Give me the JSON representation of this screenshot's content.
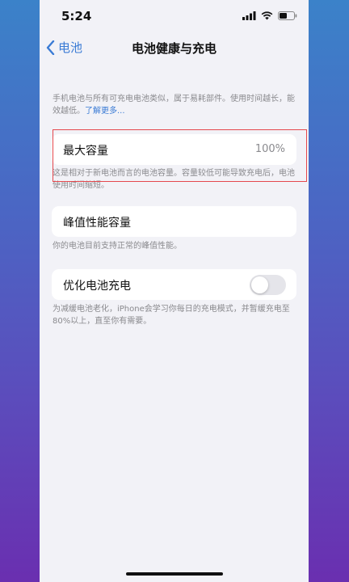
{
  "status": {
    "time": "5:24"
  },
  "nav": {
    "back_label": "电池",
    "title": "电池健康与充电"
  },
  "intro": {
    "text": "手机电池与所有可充电电池类似，属于易耗部件。使用时间越长，能效越低。",
    "link": "了解更多..."
  },
  "max_capacity": {
    "label": "最大容量",
    "value": "100%",
    "footnote": "这是相对于新电池而言的电池容量。容量较低可能导致充电后，电池使用时间缩短。"
  },
  "peak_performance": {
    "label": "峰值性能容量",
    "footnote": "你的电池目前支持正常的峰值性能。"
  },
  "optimized_charging": {
    "label": "优化电池充电",
    "enabled": false,
    "footnote": "为减缓电池老化，iPhone会学习你每日的充电模式，并暂缓充电至80%以上，直至你有需要。"
  },
  "colors": {
    "accent": "#3a7bd5",
    "highlight_box": "#e5484d"
  },
  "icons": [
    "cellular-signal-icon",
    "wifi-icon",
    "battery-icon",
    "chevron-left-icon"
  ]
}
